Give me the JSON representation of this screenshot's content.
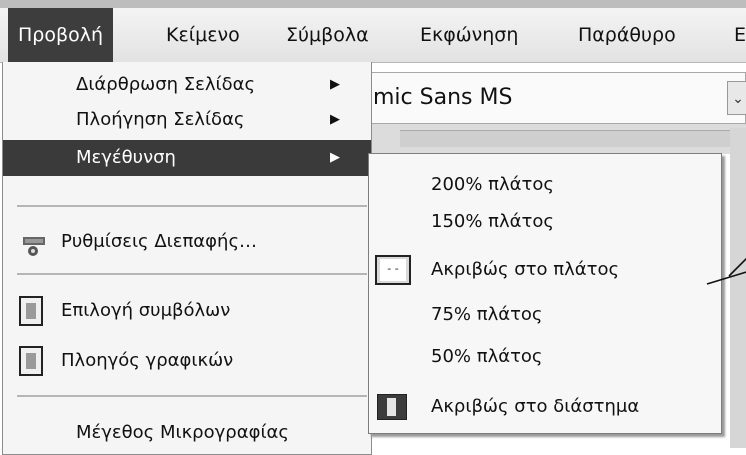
{
  "menubar": {
    "items": [
      "Προβολή",
      "Κείμενο",
      "Σύμβολα",
      "Εκφώνηση",
      "Παράθυρο",
      "Ε"
    ]
  },
  "background": {
    "font_field": "mic Sans MS",
    "dropdown_glyph": "⌄"
  },
  "menu": {
    "items": [
      {
        "label": "Διάρθρωση Σελίδας",
        "arrow": "▶"
      },
      {
        "label": "Πλοήγηση Σελίδας",
        "arrow": "▶"
      },
      {
        "label": "Μεγέθυνση",
        "arrow": "▶"
      },
      {
        "label": "Ρυθμίσεις Διεπαφής…"
      },
      {
        "label": "Επιλογή συμβόλων"
      },
      {
        "label": "Πλοηγός γραφικών"
      },
      {
        "label": "Μέγεθος Μικρογραφίας"
      }
    ]
  },
  "submenu": {
    "items": [
      {
        "label": "200% πλάτος"
      },
      {
        "label": "150% πλάτος"
      },
      {
        "label": "Ακριβώς στο πλάτος"
      },
      {
        "label": "75% πλάτος"
      },
      {
        "label": "50% πλάτος"
      },
      {
        "label": "Ακριβώς στο διάστημα"
      }
    ]
  },
  "colors": {
    "highlight": "#3a3a3a",
    "menu_bg": "#f5f5f5"
  }
}
